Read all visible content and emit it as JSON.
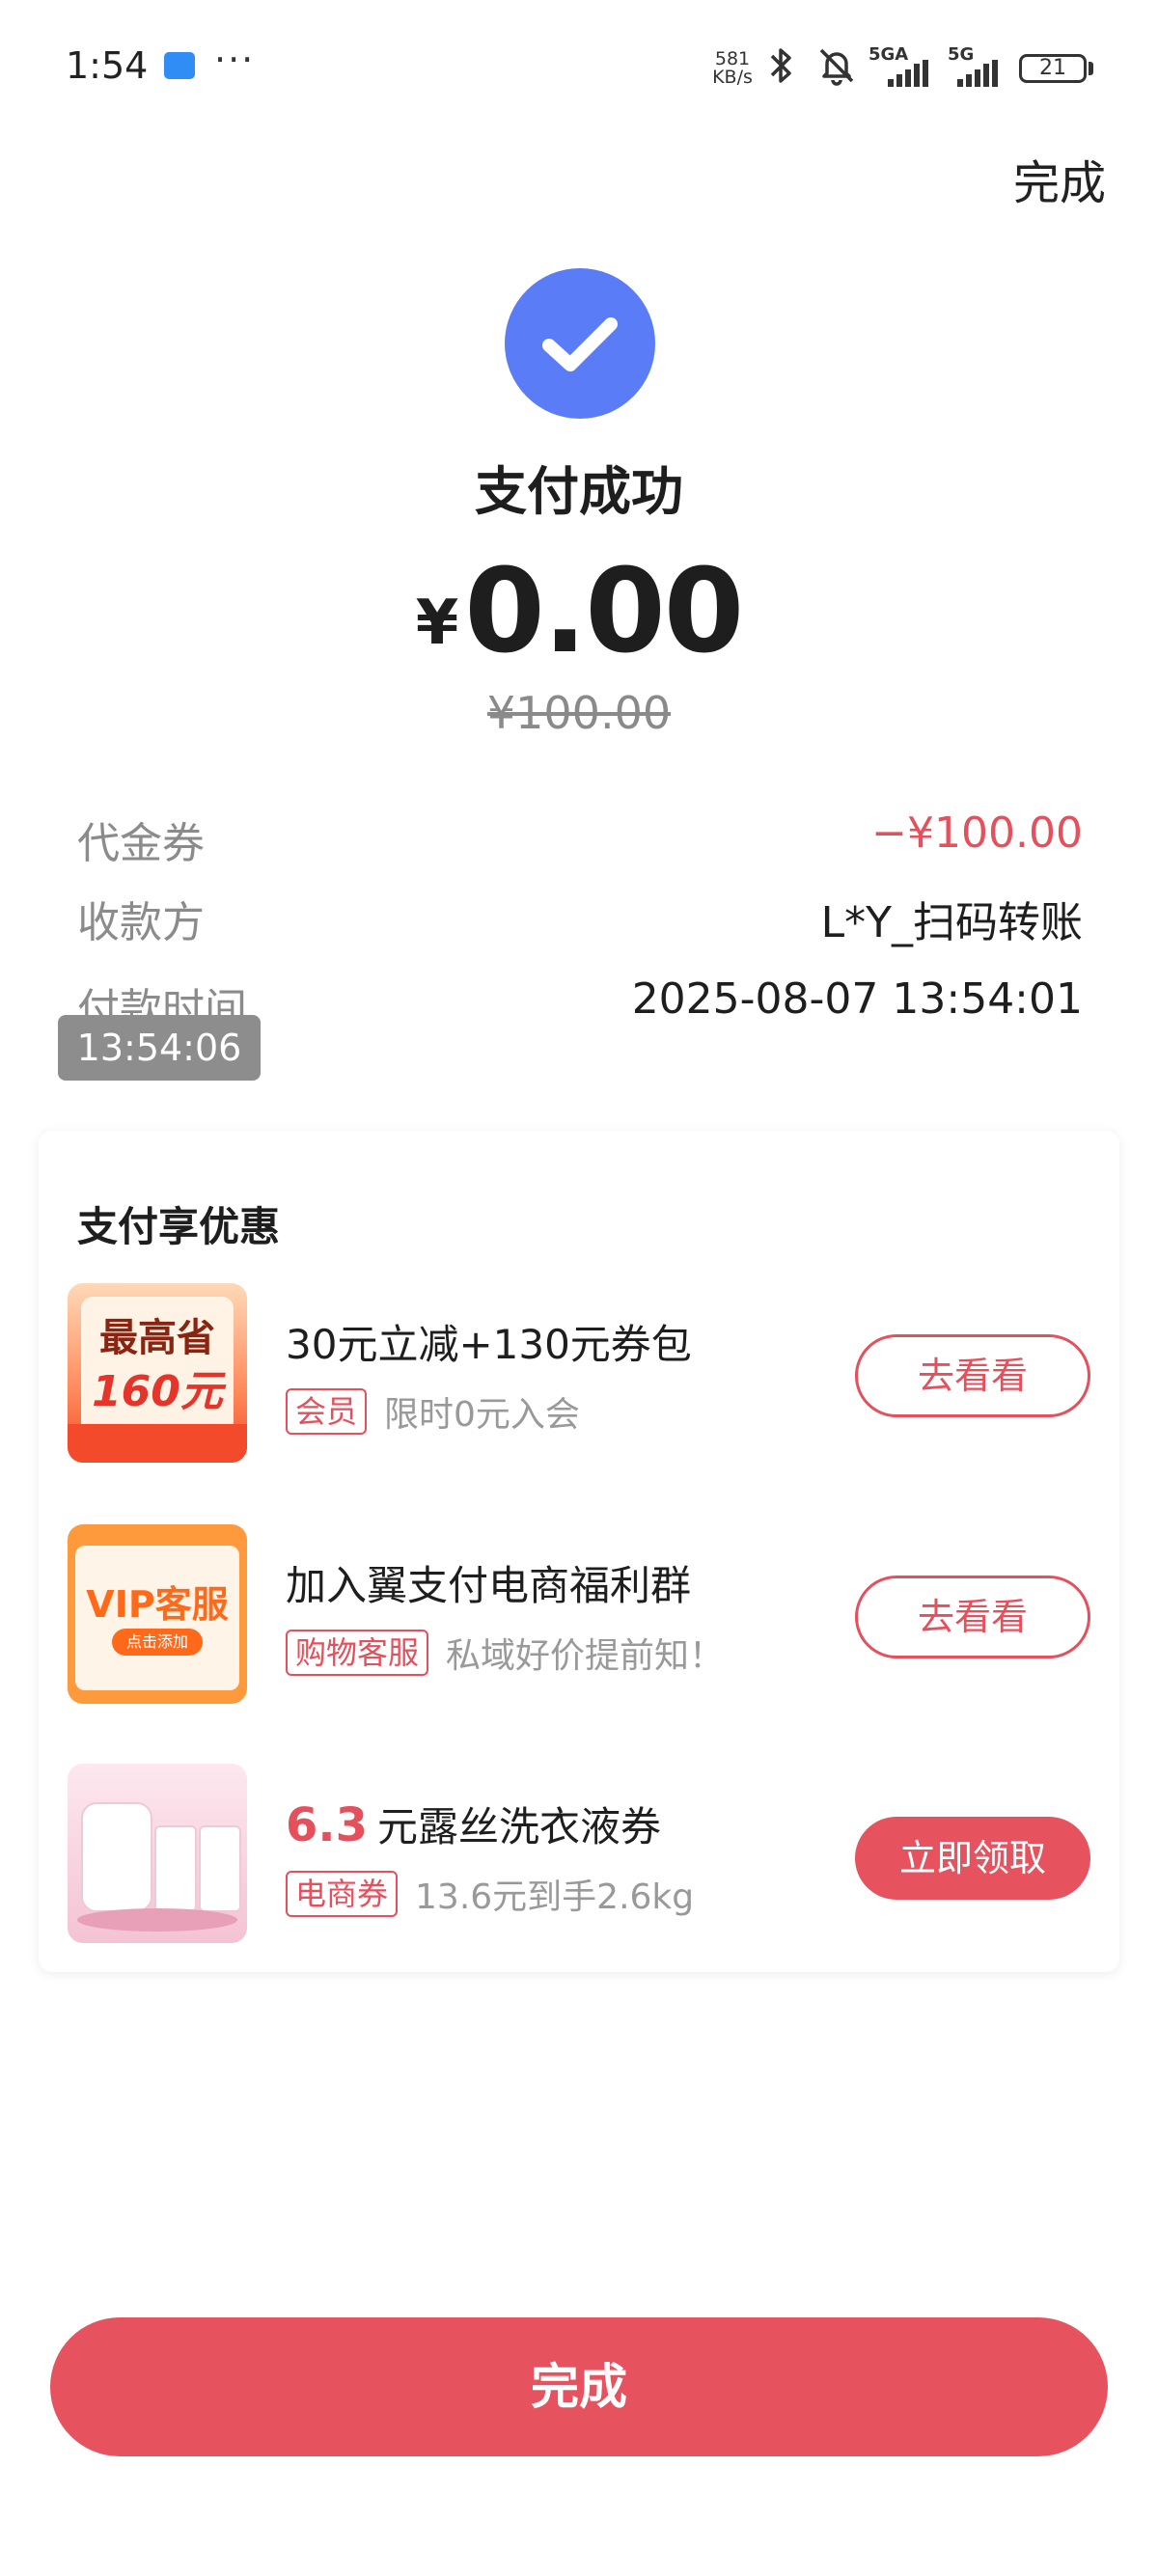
{
  "status_bar": {
    "time": "1:54",
    "more": "···",
    "net_speed_value": "581",
    "net_speed_unit": "KB/s",
    "signal1_label": "5GA",
    "signal2_label": "5G",
    "battery": "21",
    "icons": [
      "app-notification-icon",
      "bluetooth-icon",
      "mute-bell-icon",
      "signal-icon",
      "battery-icon"
    ]
  },
  "header": {
    "done_label": "完成"
  },
  "result": {
    "title": "支付成功",
    "currency": "¥",
    "amount": "0.00",
    "original_amount": "¥100.00",
    "accent_color": "#5a7cf7"
  },
  "details": [
    {
      "label": "代金券",
      "value": "−¥100.00"
    },
    {
      "label": "收款方",
      "value": "L*Y_扫码转账"
    },
    {
      "label": "付款时间",
      "value": "2025-08-07 13:54:01"
    }
  ],
  "time_overlay": "13:54:06",
  "promotions": {
    "title": "支付享优惠",
    "items": [
      {
        "thumb_line1": "最高省",
        "thumb_line2": "160元",
        "title": "30元立减+130元券包",
        "tag": "会员",
        "subtitle": "限时0元入会",
        "button": "去看看"
      },
      {
        "thumb_line1": "VIP客服",
        "thumb_line2": "点击添加",
        "title": "加入翼支付电商福利群",
        "tag": "购物客服",
        "subtitle": "私域好价提前知！",
        "button": "去看看"
      },
      {
        "highlight": "6.3",
        "title": "元露丝洗衣液券",
        "tag": "电商券",
        "subtitle": "13.6元到手2.6kg",
        "button": "立即领取"
      }
    ]
  },
  "footer": {
    "done_label": "完成",
    "brand_color": "#e6535e"
  }
}
